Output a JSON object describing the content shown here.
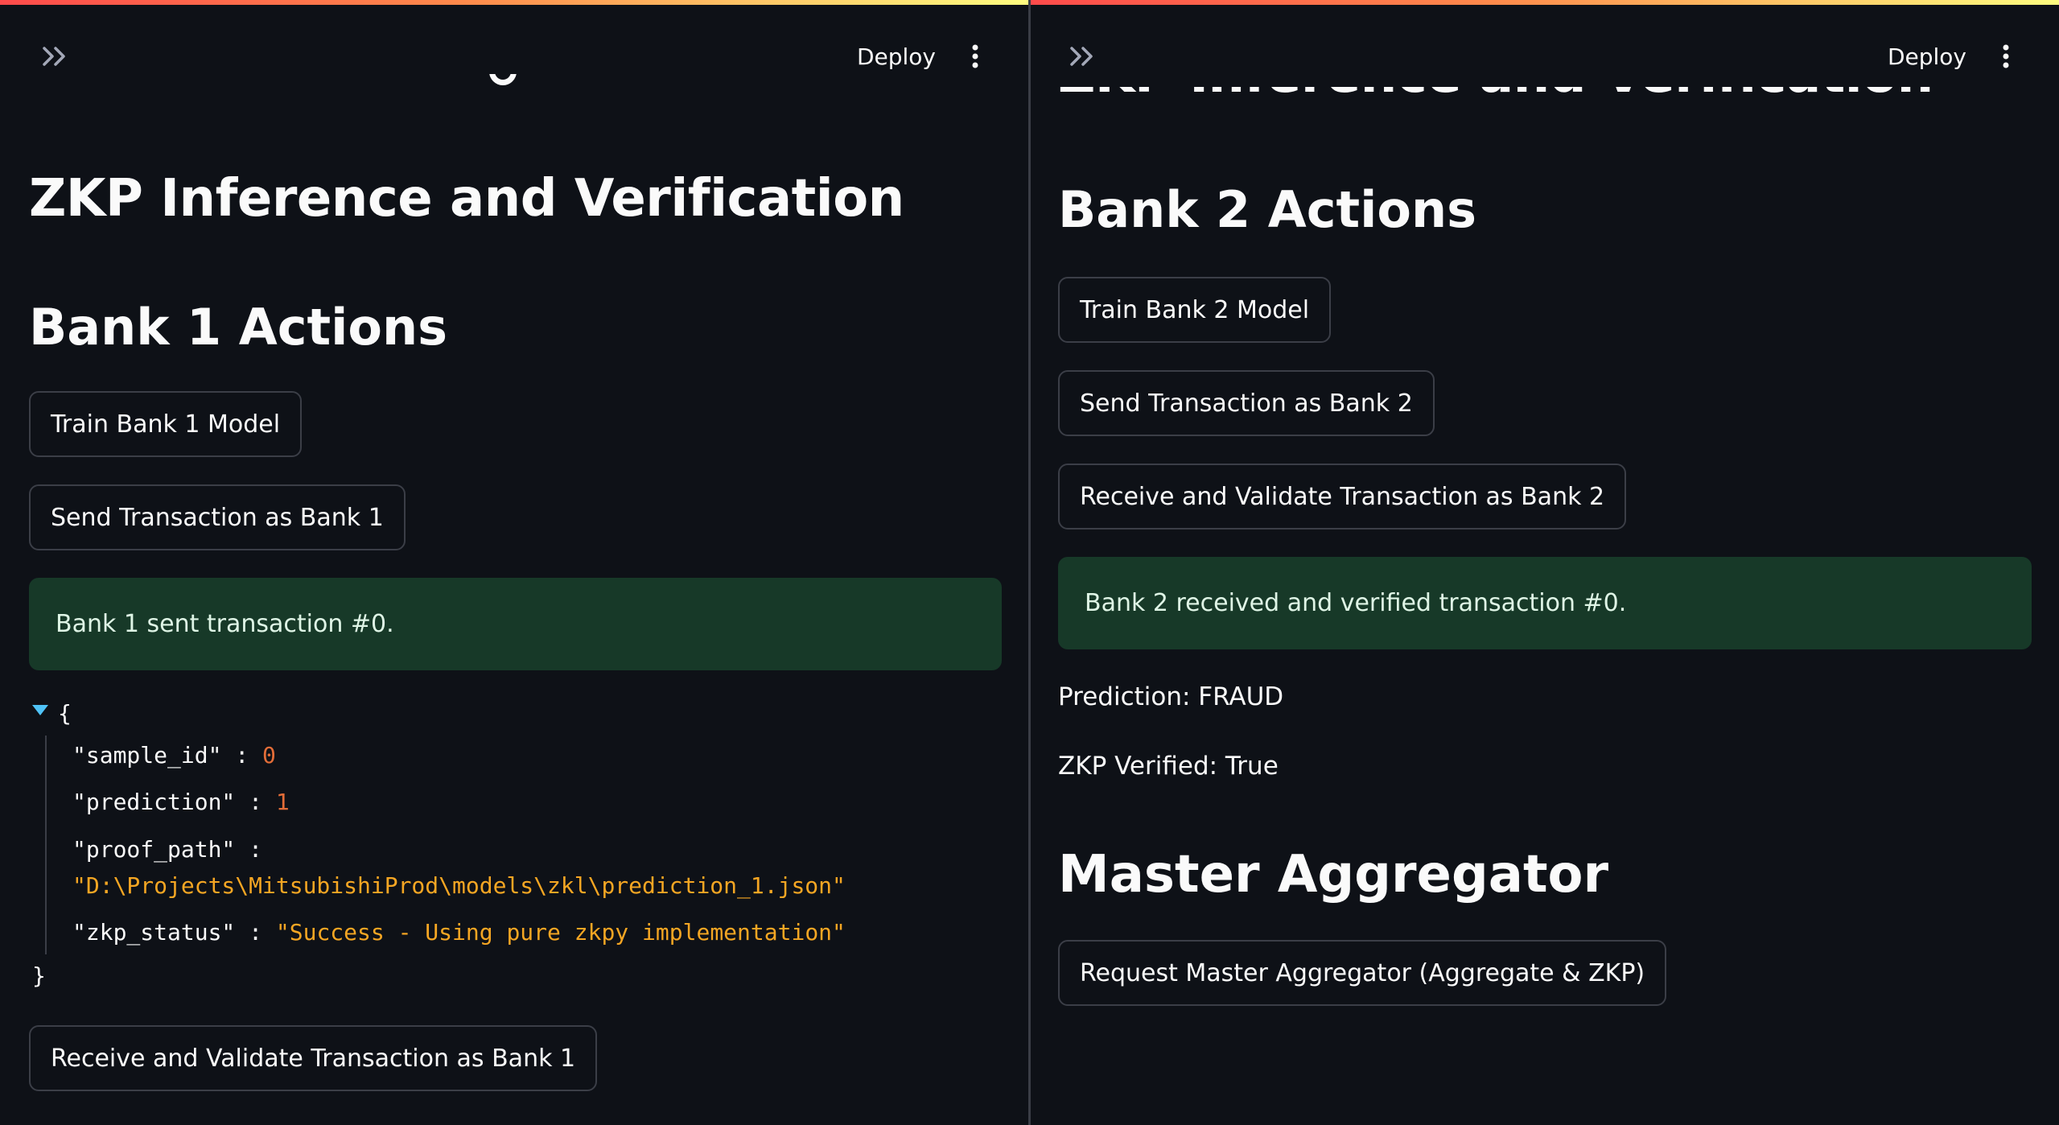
{
  "toolbar": {
    "deploy_label": "Deploy",
    "expand_icon": "double-chevron-right-icon",
    "menu_icon": "vertical-ellipsis-icon"
  },
  "colors": {
    "background": "#0e1117",
    "success_bg": "#173928",
    "button_border": "#3b3e47",
    "json_number": "#e36d38",
    "json_string": "#f5a623",
    "caret": "#4fc3f7"
  },
  "left": {
    "title": "ZKP Inference and Verification",
    "bank_header": "Bank 1 Actions",
    "train_button": "Train Bank 1 Model",
    "send_button": "Send Transaction as Bank 1",
    "success_message": "Bank 1 sent transaction #0.",
    "json": {
      "open_brace": "{",
      "close_brace": "}",
      "sample_id_key": "\"sample_id\"",
      "sample_id_value": "0",
      "prediction_key": "\"prediction\"",
      "prediction_value": "1",
      "proof_path_key": "\"proof_path\"",
      "proof_path_value": "\"D:\\Projects\\MitsubishiProd\\models\\zkl\\prediction_1.json\"",
      "zkp_status_key": "\"zkp_status\"",
      "zkp_status_value": "\"Success - Using pure zkpy implementation\"",
      "separator": ":"
    },
    "receive_button": "Receive and Validate Transaction as Bank 1"
  },
  "right": {
    "title_partial": "ZKP Inference and Verification",
    "bank_header": "Bank 2 Actions",
    "train_button": "Train Bank 2 Model",
    "send_button": "Send Transaction as Bank 2",
    "receive_button": "Receive and Validate Transaction as Bank 2",
    "success_message": "Bank 2 received and verified transaction #0.",
    "prediction_text": "Prediction: FRAUD",
    "zkp_verified_text": "ZKP Verified: True",
    "aggregator_header": "Master Aggregator",
    "aggregator_button": "Request Master Aggregator (Aggregate & ZKP)"
  }
}
